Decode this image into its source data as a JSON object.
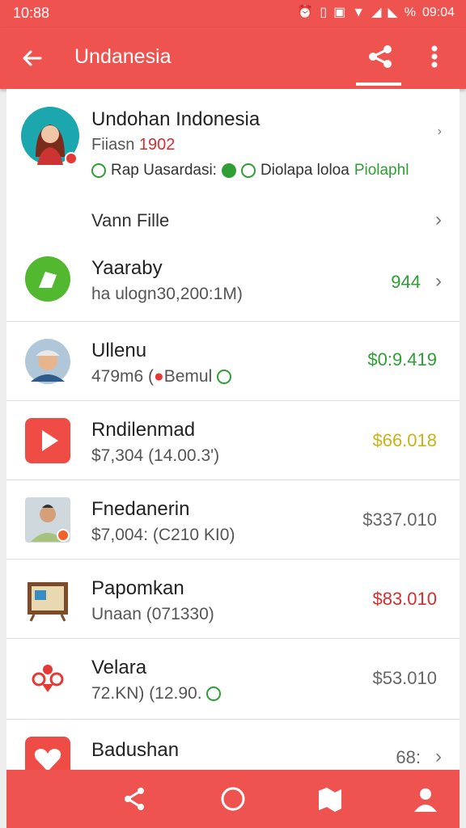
{
  "status": {
    "time": "10:88",
    "right_time": "09:04",
    "icons": [
      "alarm-icon",
      "vibrate-icon",
      "sim-icon",
      "wifi-icon",
      "signal-icon",
      "signal-x-icon",
      "percent-icon"
    ]
  },
  "appbar": {
    "title": "Undanesia",
    "back_icon": "arrow-left-icon",
    "share_icon": "share-icon",
    "more_icon": "more-vert-icon"
  },
  "profile": {
    "name": "Undohan Indonesia",
    "sub_prefix": "Fiiasn",
    "sub_number": "1902",
    "badge_left": "Rap Uasardasi:",
    "badge_right": "Diolapa loloa",
    "badge_right_green": "Piolaphl",
    "link": "Vann Fille"
  },
  "rows": [
    {
      "name": "Yaaraby",
      "sub": "ha ulogn30,200:1M)",
      "amount": "944",
      "amount_color": "#2e9e35",
      "icon": "green-leaf-icon",
      "chevron": true
    },
    {
      "name": "Ullenu",
      "sub": "479m6 (",
      "sub2": "Bemul",
      "amount": "$0:9.419",
      "amount_color": "#2e9e35",
      "icon": "person-cap-icon",
      "chevron": false
    },
    {
      "name": "Rndilenmad",
      "sub": "$7,304 (14.00.3')",
      "amount": "$66.018",
      "amount_color": "#c9b316",
      "icon": "play-icon",
      "chevron": false
    },
    {
      "name": "Fnedanerin",
      "sub": "$7,004: (C210 KI0)",
      "amount": "$337.010",
      "amount_color": "#666666",
      "icon": "person-photo-icon",
      "chevron": false
    },
    {
      "name": "Papomkan",
      "sub": "Unaan (071330)",
      "amount": "$83.010",
      "amount_color": "#d32f2f",
      "icon": "board-icon",
      "chevron": false
    },
    {
      "name": "Velara",
      "sub": "72.KN) (12.90.",
      "amount": "$53.010",
      "amount_color": "#666666",
      "icon": "flower-icon",
      "chevron": false
    },
    {
      "name": "Badushan",
      "sub": "",
      "amount": "68:",
      "amount_color": "#666666",
      "icon": "heart-icon",
      "chevron": true
    }
  ],
  "bottom": {
    "icons": [
      "share-icon",
      "circle-icon",
      "map-icon",
      "person-icon"
    ]
  }
}
